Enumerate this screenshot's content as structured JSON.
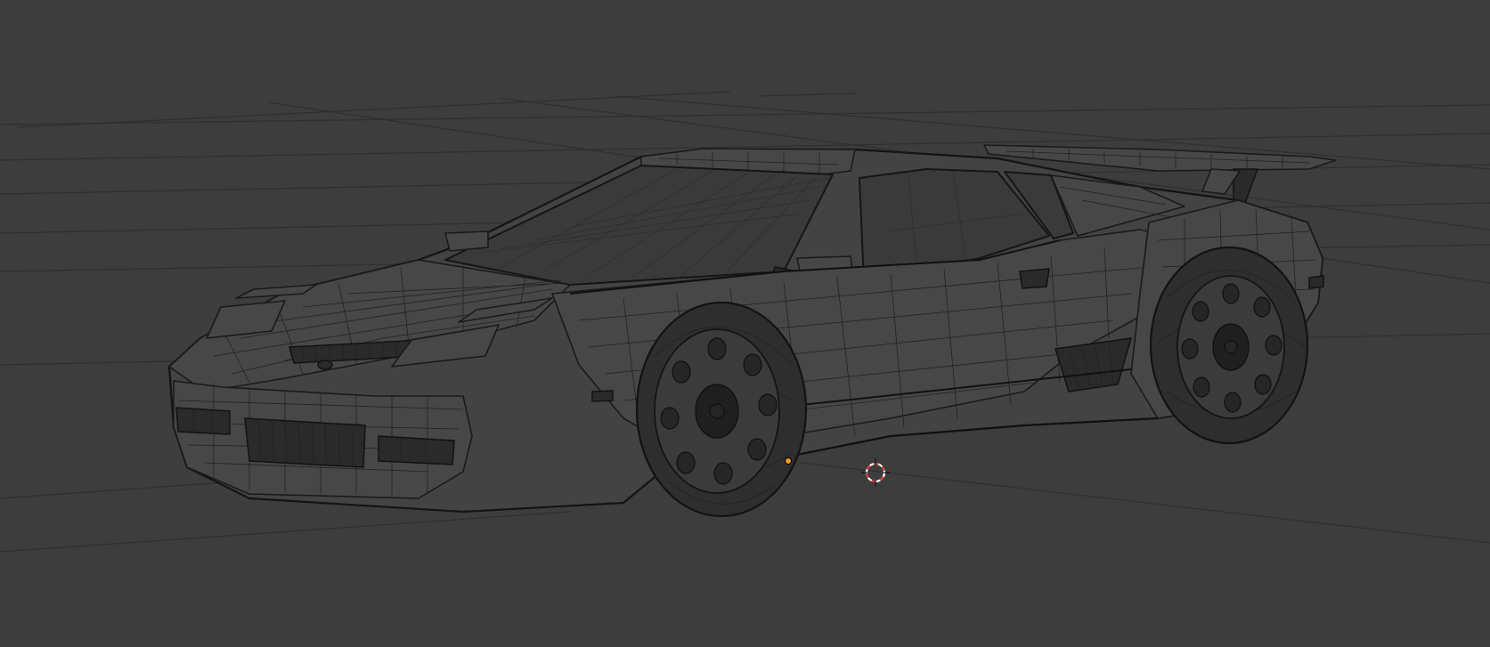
{
  "viewport": {
    "background_color": "#3d3d3d",
    "grid_color": "#2f2f2f",
    "wire_color": "#222222",
    "cursor_colors": [
      "#e04040",
      "#ffffff"
    ],
    "origin_color": "#f0a020"
  },
  "scene": {
    "object": "car-wireframe",
    "shading_mode": "wireframe"
  },
  "cursor": {
    "icon": "3d-cursor-icon"
  },
  "origin": {
    "icon": "object-origin-icon"
  }
}
